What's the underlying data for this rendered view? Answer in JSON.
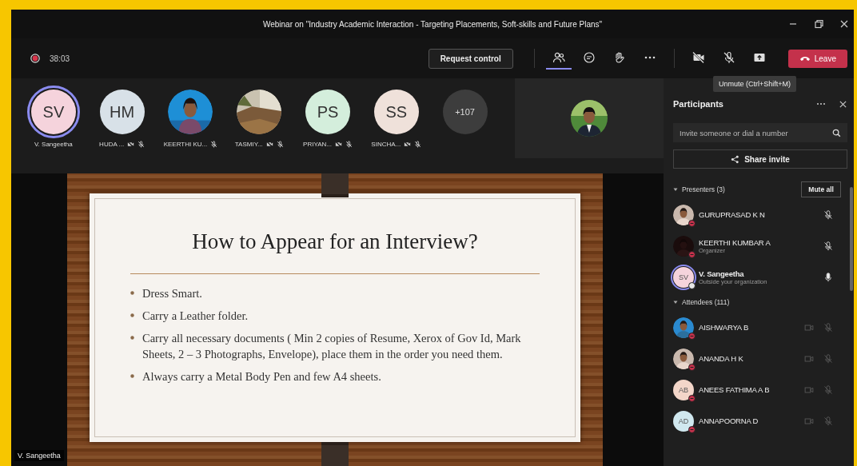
{
  "window": {
    "title": "Webinar on \"Industry Academic Interaction - Targeting Placements, Soft-skills and Future Plans\""
  },
  "meeting": {
    "recording": true,
    "duration": "38:03",
    "request_control": "Request control",
    "toolbar": [
      {
        "kind": "people",
        "selected": true
      },
      {
        "kind": "chat",
        "selected": false
      },
      {
        "kind": "hand",
        "selected": false
      },
      {
        "kind": "more",
        "selected": false
      }
    ],
    "camera_on": false,
    "mic_on": false,
    "leave": "Leave",
    "tooltip": "Unmute (Ctrl+Shift+M)"
  },
  "strip": [
    {
      "kind": "initials",
      "initials": "SV",
      "name": "V. Sangeetha",
      "color": "#f5d3dc",
      "speaking": true,
      "video_off": false,
      "muted": false
    },
    {
      "kind": "initials",
      "initials": "HM",
      "name": "HUDA ...",
      "color": "#d8e1e8",
      "speaking": false,
      "video_off": true,
      "muted": true
    },
    {
      "name": "KEERTHI KU...",
      "speaking": false,
      "video_off": false,
      "muted": true
    },
    {
      "kind": "landscape",
      "name": "TASMIY...",
      "speaking": false,
      "video_off": true,
      "muted": true
    },
    {
      "kind": "initials",
      "initials": "PS",
      "name": "PRIYAN...",
      "color": "#d4eedc",
      "speaking": false,
      "video_off": true,
      "muted": true
    },
    {
      "kind": "initials",
      "initials": "SS",
      "name": "SINCHA...",
      "color": "#efe1da",
      "speaking": false,
      "video_off": true,
      "muted": true
    },
    {
      "kind": "overflow",
      "label": "+107"
    }
  ],
  "slide": {
    "title": "How to Appear for an Interview?",
    "bullets": [
      "Dress Smart.",
      "Carry a Leather folder.",
      "Carry all necessary documents ( Min 2 copies of Resume, Xerox of Gov Id, Mark Sheets, 2 – 3 Photographs, Envelope), place them in the order you need them.",
      "Always carry a Metal Body Pen and few A4 sheets."
    ]
  },
  "presenter_label": "V. Sangeetha",
  "participants_panel": {
    "title": "Participants",
    "search": {
      "placeholder": "Invite someone or dial a number"
    },
    "share_invite": "Share invite",
    "sections": [
      {
        "title": "Presenters (3)",
        "expanded": true,
        "action": "Mute all",
        "members": [
          {
            "kind": "presenter",
            "name": "GURUPRASAD K N",
            "external": false,
            "muted": true
          },
          {
            "kind": "presenter",
            "name": "KEERTHI KUMBAR A",
            "subtitle": "Organizer",
            "external": false,
            "muted": true
          },
          {
            "kind": "presenter",
            "initials": "SV",
            "color": "#f5d3dc",
            "name": "V. Sangeetha",
            "subtitle": "Outside your organization",
            "external": true,
            "muted": false
          }
        ]
      },
      {
        "title": "Attendees (111)",
        "expanded": true,
        "members": [
          {
            "kind": "attendee",
            "name": "AISHWARYA B",
            "external": false
          },
          {
            "kind": "attendee",
            "name": "ANANDA H K",
            "external": false
          },
          {
            "kind": "attendee",
            "initials": "AB",
            "color": "#f3d6c9",
            "name": "ANEES FATHIMA A B",
            "external": false
          },
          {
            "kind": "attendee",
            "initials": "AD",
            "color": "#d0e8ef",
            "name": "ANNAPOORNA D",
            "external": false
          }
        ]
      }
    ]
  }
}
